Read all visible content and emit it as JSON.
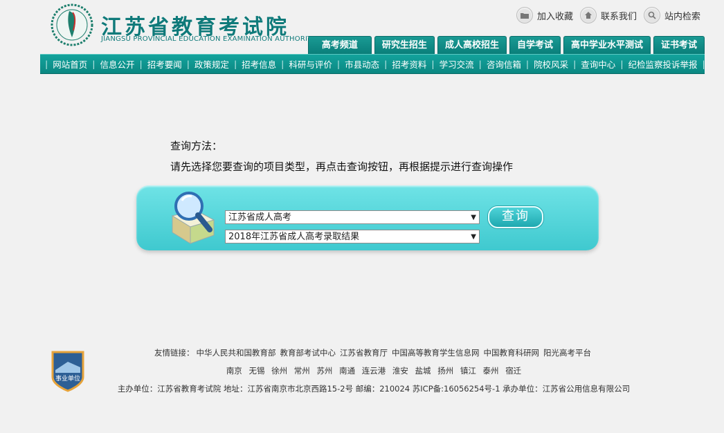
{
  "header": {
    "title_cn": "江苏省教育考试院",
    "title_en": "JIANGSU PROVINCIAL EDUCATION EXAMINATION AUTHORITY",
    "top_links": [
      "加入收藏",
      "联系我们",
      "站内检索"
    ],
    "tabs": [
      "高考频道",
      "研究生招生",
      "成人高校招生",
      "自学考试",
      "高中学业水平测试",
      "证书考试"
    ]
  },
  "nav": {
    "items": [
      "网站首页",
      "信息公开",
      "招考要闻",
      "政策规定",
      "招考信息",
      "科研与评价",
      "市县动态",
      "招考资料",
      "学习交流",
      "咨询信箱",
      "院校风采",
      "查询中心",
      "纪检监察投诉举报"
    ]
  },
  "main": {
    "instr_title": "查询方法：",
    "instr_text": "请先选择您要查询的项目类型，再点击查询按钮，再根据提示进行查询操作",
    "select1_value": "江苏省成人高考",
    "select2_value": "2018年江苏省成人高考录取结果",
    "query_label": "查询"
  },
  "footer": {
    "links_label": "友情链接：",
    "links": [
      "中华人民共和国教育部",
      "教育部考试中心",
      "江苏省教育厅",
      "中国高等教育学生信息网",
      "中国教育科研网",
      "阳光高考平台"
    ],
    "cities": [
      "南京",
      "无锡",
      "徐州",
      "常州",
      "苏州",
      "南通",
      "连云港",
      "淮安",
      "盐城",
      "扬州",
      "镇江",
      "泰州",
      "宿迁"
    ],
    "info": "主办单位：江苏省教育考试院  地址：江苏省南京市北京西路15-2号  邮编：210024  苏ICP备:16056254号-1  承办单位：江苏省公用信息有限公司",
    "badge_text": "事业单位"
  },
  "colors": {
    "accent": "#0b8882",
    "panel": "#4fcfd5"
  }
}
